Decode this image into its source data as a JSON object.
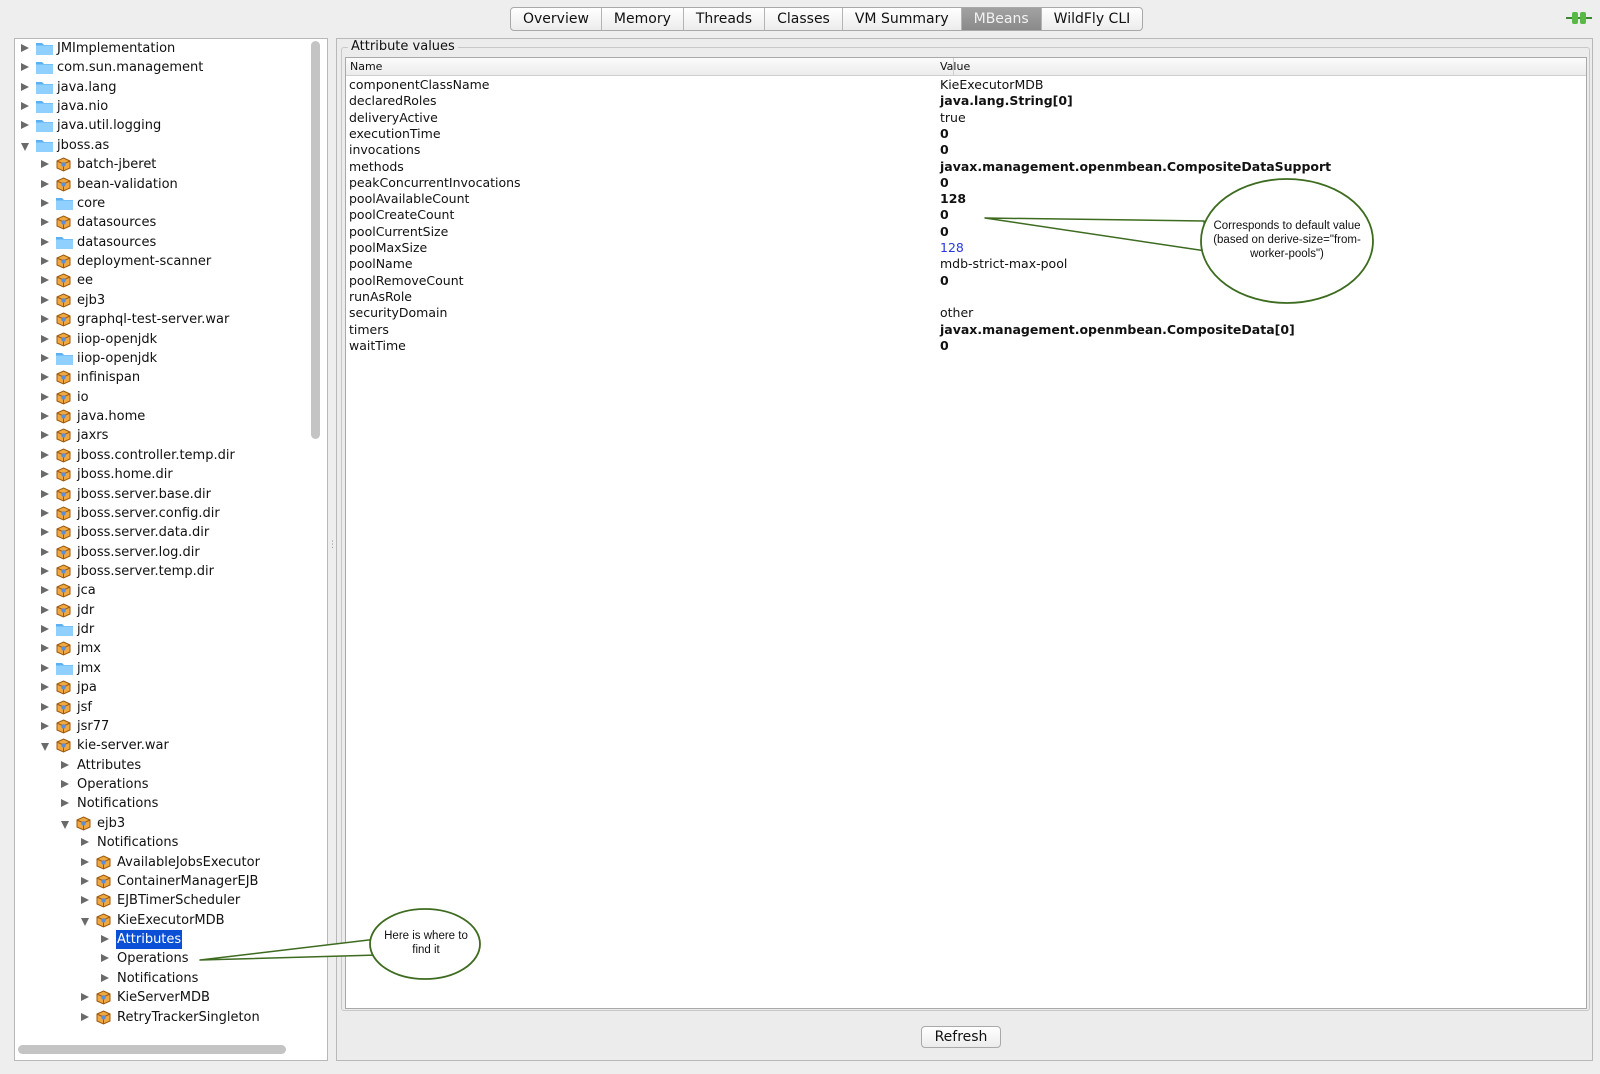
{
  "tabs": [
    {
      "label": "Overview",
      "active": false
    },
    {
      "label": "Memory",
      "active": false
    },
    {
      "label": "Threads",
      "active": false
    },
    {
      "label": "Classes",
      "active": false
    },
    {
      "label": "VM Summary",
      "active": false
    },
    {
      "label": "MBeans",
      "active": true
    },
    {
      "label": "WildFly CLI",
      "active": false
    }
  ],
  "tree": [
    {
      "label": "JMImplementation",
      "depth": 0,
      "icon": "folder",
      "state": "closed"
    },
    {
      "label": "com.sun.management",
      "depth": 0,
      "icon": "folder",
      "state": "closed"
    },
    {
      "label": "java.lang",
      "depth": 0,
      "icon": "folder",
      "state": "closed"
    },
    {
      "label": "java.nio",
      "depth": 0,
      "icon": "folder",
      "state": "closed"
    },
    {
      "label": "java.util.logging",
      "depth": 0,
      "icon": "folder",
      "state": "closed"
    },
    {
      "label": "jboss.as",
      "depth": 0,
      "icon": "folder",
      "state": "open"
    },
    {
      "label": "batch-jberet",
      "depth": 1,
      "icon": "bean",
      "state": "closed"
    },
    {
      "label": "bean-validation",
      "depth": 1,
      "icon": "bean",
      "state": "closed"
    },
    {
      "label": "core",
      "depth": 1,
      "icon": "folder",
      "state": "closed"
    },
    {
      "label": "datasources",
      "depth": 1,
      "icon": "bean",
      "state": "closed"
    },
    {
      "label": "datasources",
      "depth": 1,
      "icon": "folder",
      "state": "closed"
    },
    {
      "label": "deployment-scanner",
      "depth": 1,
      "icon": "bean",
      "state": "closed"
    },
    {
      "label": "ee",
      "depth": 1,
      "icon": "bean",
      "state": "closed"
    },
    {
      "label": "ejb3",
      "depth": 1,
      "icon": "bean",
      "state": "closed"
    },
    {
      "label": "graphql-test-server.war",
      "depth": 1,
      "icon": "bean",
      "state": "closed"
    },
    {
      "label": "iiop-openjdk",
      "depth": 1,
      "icon": "bean",
      "state": "closed"
    },
    {
      "label": "iiop-openjdk",
      "depth": 1,
      "icon": "folder",
      "state": "closed"
    },
    {
      "label": "infinispan",
      "depth": 1,
      "icon": "bean",
      "state": "closed"
    },
    {
      "label": "io",
      "depth": 1,
      "icon": "bean",
      "state": "closed"
    },
    {
      "label": "java.home",
      "depth": 1,
      "icon": "bean",
      "state": "closed"
    },
    {
      "label": "jaxrs",
      "depth": 1,
      "icon": "bean",
      "state": "closed"
    },
    {
      "label": "jboss.controller.temp.dir",
      "depth": 1,
      "icon": "bean",
      "state": "closed"
    },
    {
      "label": "jboss.home.dir",
      "depth": 1,
      "icon": "bean",
      "state": "closed"
    },
    {
      "label": "jboss.server.base.dir",
      "depth": 1,
      "icon": "bean",
      "state": "closed"
    },
    {
      "label": "jboss.server.config.dir",
      "depth": 1,
      "icon": "bean",
      "state": "closed"
    },
    {
      "label": "jboss.server.data.dir",
      "depth": 1,
      "icon": "bean",
      "state": "closed"
    },
    {
      "label": "jboss.server.log.dir",
      "depth": 1,
      "icon": "bean",
      "state": "closed"
    },
    {
      "label": "jboss.server.temp.dir",
      "depth": 1,
      "icon": "bean",
      "state": "closed"
    },
    {
      "label": "jca",
      "depth": 1,
      "icon": "bean",
      "state": "closed"
    },
    {
      "label": "jdr",
      "depth": 1,
      "icon": "bean",
      "state": "closed"
    },
    {
      "label": "jdr",
      "depth": 1,
      "icon": "folder",
      "state": "closed"
    },
    {
      "label": "jmx",
      "depth": 1,
      "icon": "bean",
      "state": "closed"
    },
    {
      "label": "jmx",
      "depth": 1,
      "icon": "folder",
      "state": "closed"
    },
    {
      "label": "jpa",
      "depth": 1,
      "icon": "bean",
      "state": "closed"
    },
    {
      "label": "jsf",
      "depth": 1,
      "icon": "bean",
      "state": "closed"
    },
    {
      "label": "jsr77",
      "depth": 1,
      "icon": "bean",
      "state": "closed"
    },
    {
      "label": "kie-server.war",
      "depth": 1,
      "icon": "bean",
      "state": "open"
    },
    {
      "label": "Attributes",
      "depth": 2,
      "icon": "none",
      "state": "closed"
    },
    {
      "label": "Operations",
      "depth": 2,
      "icon": "none",
      "state": "closed"
    },
    {
      "label": "Notifications",
      "depth": 2,
      "icon": "none",
      "state": "closed"
    },
    {
      "label": "ejb3",
      "depth": 2,
      "icon": "bean",
      "state": "open"
    },
    {
      "label": "Notifications",
      "depth": 3,
      "icon": "none",
      "state": "closed"
    },
    {
      "label": "AvailableJobsExecutor",
      "depth": 3,
      "icon": "bean",
      "state": "closed"
    },
    {
      "label": "ContainerManagerEJB",
      "depth": 3,
      "icon": "bean",
      "state": "closed"
    },
    {
      "label": "EJBTimerScheduler",
      "depth": 3,
      "icon": "bean",
      "state": "closed"
    },
    {
      "label": "KieExecutorMDB",
      "depth": 3,
      "icon": "bean",
      "state": "open"
    },
    {
      "label": "Attributes",
      "depth": 4,
      "icon": "none",
      "state": "closed",
      "selected": true
    },
    {
      "label": "Operations",
      "depth": 4,
      "icon": "none",
      "state": "closed"
    },
    {
      "label": "Notifications",
      "depth": 4,
      "icon": "none",
      "state": "closed"
    },
    {
      "label": "KieServerMDB",
      "depth": 3,
      "icon": "bean",
      "state": "closed"
    },
    {
      "label": "RetryTrackerSingleton",
      "depth": 3,
      "icon": "bean",
      "state": "closed"
    }
  ],
  "attributes_panel": {
    "title": "Attribute values",
    "columns": {
      "name": "Name",
      "value": "Value"
    },
    "rows": [
      {
        "name": "componentClassName",
        "value": "KieExecutorMDB",
        "style": "normal"
      },
      {
        "name": "declaredRoles",
        "value": "java.lang.String[0]",
        "style": "bold"
      },
      {
        "name": "deliveryActive",
        "value": "true",
        "style": "normal"
      },
      {
        "name": "executionTime",
        "value": "0",
        "style": "bold"
      },
      {
        "name": "invocations",
        "value": "0",
        "style": "bold"
      },
      {
        "name": "methods",
        "value": "javax.management.openmbean.CompositeDataSupport",
        "style": "bold"
      },
      {
        "name": "peakConcurrentInvocations",
        "value": "0",
        "style": "bold"
      },
      {
        "name": "poolAvailableCount",
        "value": "128",
        "style": "bold"
      },
      {
        "name": "poolCreateCount",
        "value": "0",
        "style": "bold"
      },
      {
        "name": "poolCurrentSize",
        "value": "0",
        "style": "bold"
      },
      {
        "name": "poolMaxSize",
        "value": "128",
        "style": "blue"
      },
      {
        "name": "poolName",
        "value": "mdb-strict-max-pool",
        "style": "normal"
      },
      {
        "name": "poolRemoveCount",
        "value": "0",
        "style": "bold"
      },
      {
        "name": "runAsRole",
        "value": "",
        "style": "normal"
      },
      {
        "name": "securityDomain",
        "value": "other",
        "style": "normal"
      },
      {
        "name": "timers",
        "value": "javax.management.openmbean.CompositeData[0]",
        "style": "bold"
      },
      {
        "name": "waitTime",
        "value": "0",
        "style": "bold"
      }
    ],
    "refresh_label": "Refresh"
  },
  "callouts": {
    "default_value": "Corresponds to default value (based on derive-size=\"from-worker-pools\")",
    "where_to_find": "Here is where to find it"
  },
  "colors": {
    "selection": "#0a4fd6",
    "folder": "#5ab0f0",
    "callout_stroke": "#3d6b1f",
    "link_value": "#2a39e0"
  }
}
